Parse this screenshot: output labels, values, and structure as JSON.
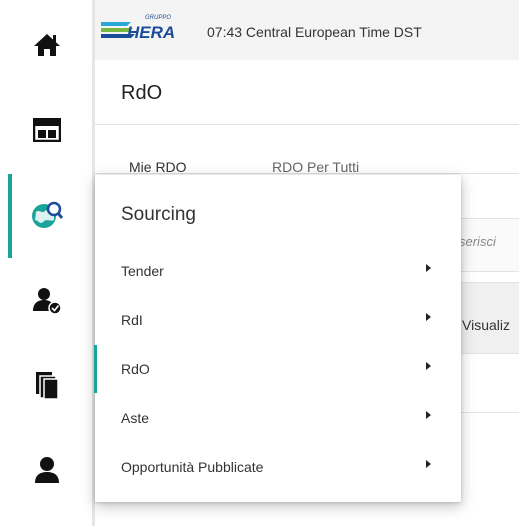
{
  "header": {
    "logo_text": "HERA",
    "logo_small_text": "GRUPPO",
    "clock": "07:43 Central European Time DST"
  },
  "page": {
    "title": "RdO"
  },
  "tabs": [
    {
      "label": "Mie RDO"
    },
    {
      "label": "RDO Per Tutti"
    }
  ],
  "search": {
    "partial_placeholder": "serisci"
  },
  "actions": {
    "partial_label": "Visualiz"
  },
  "rail": {
    "items": [
      {
        "icon": "home-icon"
      },
      {
        "icon": "dashboard-icon"
      },
      {
        "icon": "globe-search-icon"
      },
      {
        "icon": "user-check-icon"
      },
      {
        "icon": "documents-icon"
      },
      {
        "icon": "user-icon"
      }
    ],
    "active_index": 2
  },
  "menu": {
    "title": "Sourcing",
    "items": [
      {
        "label": "Tender"
      },
      {
        "label": "RdI"
      },
      {
        "label": "RdO"
      },
      {
        "label": "Aste"
      },
      {
        "label": "Opportunità Pubblicate"
      }
    ],
    "active_index": 2
  },
  "colors": {
    "accent": "#1aa39a",
    "logo_blue": "#1b4c9a",
    "logo_green": "#78b843",
    "logo_cyan": "#2aa7d9"
  }
}
